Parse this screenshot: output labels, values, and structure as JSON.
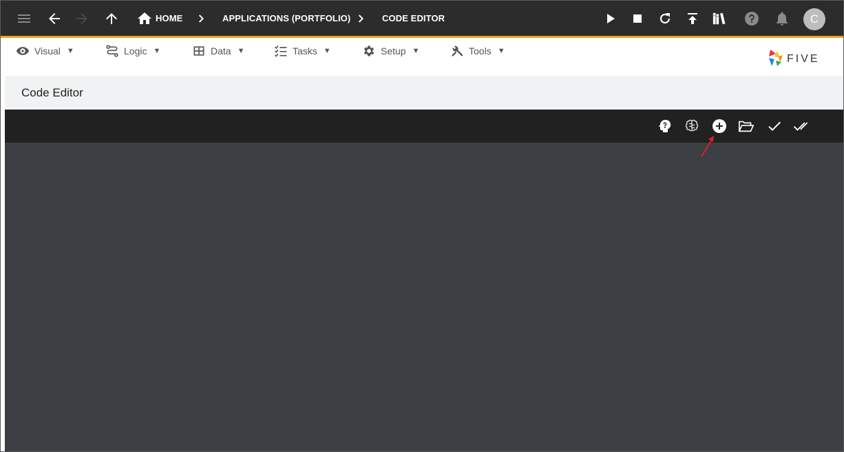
{
  "header": {
    "breadcrumbs": [
      {
        "label": "HOME"
      },
      {
        "label": "APPLICATIONS (PORTFOLIO)"
      },
      {
        "label": "CODE EDITOR"
      }
    ],
    "user_initial": "C",
    "accent_color": "#f0a51c"
  },
  "menu": {
    "items": [
      {
        "label": "Visual",
        "icon": "eye-icon"
      },
      {
        "label": "Logic",
        "icon": "logic-icon"
      },
      {
        "label": "Data",
        "icon": "table-icon"
      },
      {
        "label": "Tasks",
        "icon": "tasks-icon"
      },
      {
        "label": "Setup",
        "icon": "gear-icon"
      },
      {
        "label": "Tools",
        "icon": "tools-icon"
      }
    ],
    "caret": "▼"
  },
  "brand": {
    "logo_text": "FIVE"
  },
  "page": {
    "title": "Code Editor"
  },
  "toolbar": {
    "buttons": [
      "help-head-icon",
      "brain-icon",
      "add-circle-icon",
      "open-folder-icon",
      "check-icon",
      "double-check-icon"
    ]
  },
  "annotation": {
    "color": "#e02020"
  }
}
